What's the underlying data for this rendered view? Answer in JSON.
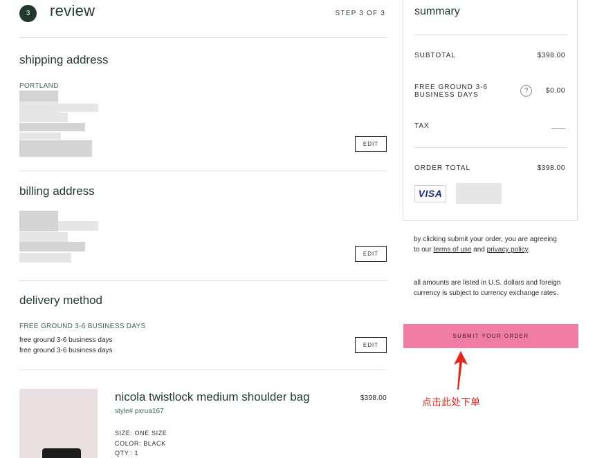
{
  "review": {
    "step_number": "3",
    "title": "review",
    "step_label": "STEP 3 OF 3"
  },
  "shipping": {
    "title": "shipping address",
    "city": "PORTLAND",
    "edit_label": "EDIT"
  },
  "billing": {
    "title": "billing address",
    "edit_label": "EDIT"
  },
  "delivery": {
    "title": "delivery method",
    "method_upper": "FREE GROUND 3-6 BUSINESS DAYS",
    "line1": "free ground 3-6 business days",
    "line2": "free ground 3-6 business days",
    "edit_label": "EDIT"
  },
  "product": {
    "name": "nicola twistlock medium shoulder bag",
    "style": "style# pxrua167",
    "price": "$398.00",
    "size": "SIZE: ONE SIZE",
    "color": "COLOR: BLACK",
    "qty": "QTY.: 1"
  },
  "summary": {
    "title": "summary",
    "subtotal_label": "SUBTOTAL",
    "subtotal_value": "$398.00",
    "shipping_label_line1": "FREE GROUND 3-6",
    "shipping_label_line2": "BUSINESS DAYS",
    "shipping_value": "$0.00",
    "help_icon": "?",
    "tax_label": "TAX",
    "order_total_label": "ORDER TOTAL",
    "order_total_value": "$398.00",
    "card_brand": "VISA"
  },
  "legal": {
    "agree_prefix": "by clicking submit your order, you are agreeing to our ",
    "terms_link": "terms of use",
    "and": " and ",
    "privacy_link": "privacy policy",
    "period": ".",
    "currency_note": "all amounts are listed in U.S. dollars and foreign currency is subject to currency exchange rates."
  },
  "submit_label": "SUBMIT YOUR ORDER",
  "annotation": "点击此处下单",
  "colors": {
    "accent_green": "#1f3a2b",
    "submit_pink": "#f27da4",
    "annotation_red": "#e8231b"
  }
}
